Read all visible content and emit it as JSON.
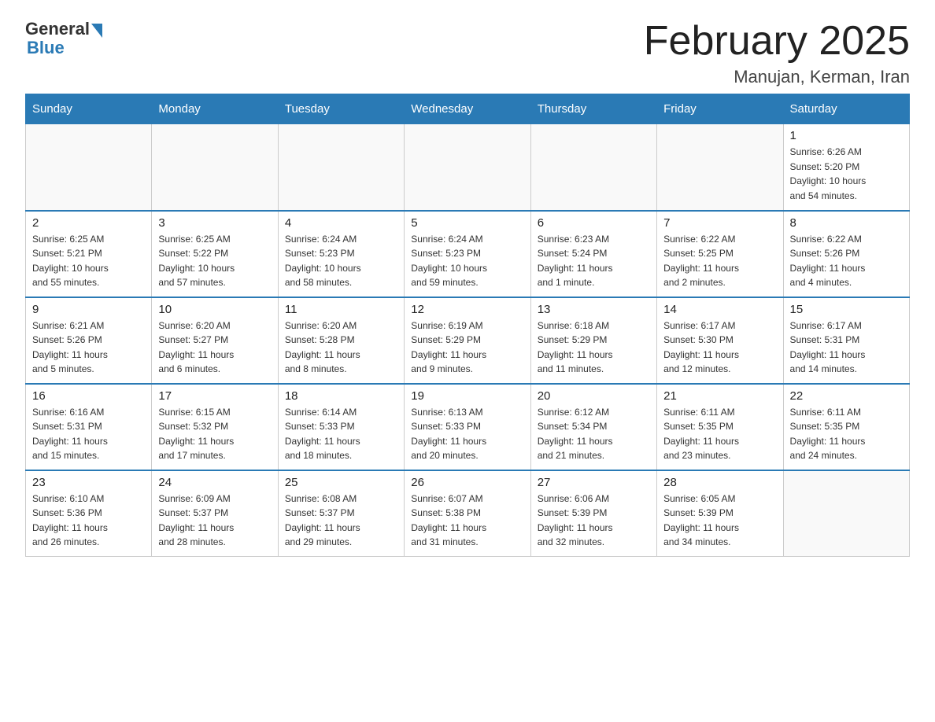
{
  "header": {
    "title": "February 2025",
    "location": "Manujan, Kerman, Iran",
    "logo_general": "General",
    "logo_blue": "Blue"
  },
  "weekdays": [
    "Sunday",
    "Monday",
    "Tuesday",
    "Wednesday",
    "Thursday",
    "Friday",
    "Saturday"
  ],
  "weeks": [
    [
      {
        "day": "",
        "info": ""
      },
      {
        "day": "",
        "info": ""
      },
      {
        "day": "",
        "info": ""
      },
      {
        "day": "",
        "info": ""
      },
      {
        "day": "",
        "info": ""
      },
      {
        "day": "",
        "info": ""
      },
      {
        "day": "1",
        "info": "Sunrise: 6:26 AM\nSunset: 5:20 PM\nDaylight: 10 hours\nand 54 minutes."
      }
    ],
    [
      {
        "day": "2",
        "info": "Sunrise: 6:25 AM\nSunset: 5:21 PM\nDaylight: 10 hours\nand 55 minutes."
      },
      {
        "day": "3",
        "info": "Sunrise: 6:25 AM\nSunset: 5:22 PM\nDaylight: 10 hours\nand 57 minutes."
      },
      {
        "day": "4",
        "info": "Sunrise: 6:24 AM\nSunset: 5:23 PM\nDaylight: 10 hours\nand 58 minutes."
      },
      {
        "day": "5",
        "info": "Sunrise: 6:24 AM\nSunset: 5:23 PM\nDaylight: 10 hours\nand 59 minutes."
      },
      {
        "day": "6",
        "info": "Sunrise: 6:23 AM\nSunset: 5:24 PM\nDaylight: 11 hours\nand 1 minute."
      },
      {
        "day": "7",
        "info": "Sunrise: 6:22 AM\nSunset: 5:25 PM\nDaylight: 11 hours\nand 2 minutes."
      },
      {
        "day": "8",
        "info": "Sunrise: 6:22 AM\nSunset: 5:26 PM\nDaylight: 11 hours\nand 4 minutes."
      }
    ],
    [
      {
        "day": "9",
        "info": "Sunrise: 6:21 AM\nSunset: 5:26 PM\nDaylight: 11 hours\nand 5 minutes."
      },
      {
        "day": "10",
        "info": "Sunrise: 6:20 AM\nSunset: 5:27 PM\nDaylight: 11 hours\nand 6 minutes."
      },
      {
        "day": "11",
        "info": "Sunrise: 6:20 AM\nSunset: 5:28 PM\nDaylight: 11 hours\nand 8 minutes."
      },
      {
        "day": "12",
        "info": "Sunrise: 6:19 AM\nSunset: 5:29 PM\nDaylight: 11 hours\nand 9 minutes."
      },
      {
        "day": "13",
        "info": "Sunrise: 6:18 AM\nSunset: 5:29 PM\nDaylight: 11 hours\nand 11 minutes."
      },
      {
        "day": "14",
        "info": "Sunrise: 6:17 AM\nSunset: 5:30 PM\nDaylight: 11 hours\nand 12 minutes."
      },
      {
        "day": "15",
        "info": "Sunrise: 6:17 AM\nSunset: 5:31 PM\nDaylight: 11 hours\nand 14 minutes."
      }
    ],
    [
      {
        "day": "16",
        "info": "Sunrise: 6:16 AM\nSunset: 5:31 PM\nDaylight: 11 hours\nand 15 minutes."
      },
      {
        "day": "17",
        "info": "Sunrise: 6:15 AM\nSunset: 5:32 PM\nDaylight: 11 hours\nand 17 minutes."
      },
      {
        "day": "18",
        "info": "Sunrise: 6:14 AM\nSunset: 5:33 PM\nDaylight: 11 hours\nand 18 minutes."
      },
      {
        "day": "19",
        "info": "Sunrise: 6:13 AM\nSunset: 5:33 PM\nDaylight: 11 hours\nand 20 minutes."
      },
      {
        "day": "20",
        "info": "Sunrise: 6:12 AM\nSunset: 5:34 PM\nDaylight: 11 hours\nand 21 minutes."
      },
      {
        "day": "21",
        "info": "Sunrise: 6:11 AM\nSunset: 5:35 PM\nDaylight: 11 hours\nand 23 minutes."
      },
      {
        "day": "22",
        "info": "Sunrise: 6:11 AM\nSunset: 5:35 PM\nDaylight: 11 hours\nand 24 minutes."
      }
    ],
    [
      {
        "day": "23",
        "info": "Sunrise: 6:10 AM\nSunset: 5:36 PM\nDaylight: 11 hours\nand 26 minutes."
      },
      {
        "day": "24",
        "info": "Sunrise: 6:09 AM\nSunset: 5:37 PM\nDaylight: 11 hours\nand 28 minutes."
      },
      {
        "day": "25",
        "info": "Sunrise: 6:08 AM\nSunset: 5:37 PM\nDaylight: 11 hours\nand 29 minutes."
      },
      {
        "day": "26",
        "info": "Sunrise: 6:07 AM\nSunset: 5:38 PM\nDaylight: 11 hours\nand 31 minutes."
      },
      {
        "day": "27",
        "info": "Sunrise: 6:06 AM\nSunset: 5:39 PM\nDaylight: 11 hours\nand 32 minutes."
      },
      {
        "day": "28",
        "info": "Sunrise: 6:05 AM\nSunset: 5:39 PM\nDaylight: 11 hours\nand 34 minutes."
      },
      {
        "day": "",
        "info": ""
      }
    ]
  ]
}
